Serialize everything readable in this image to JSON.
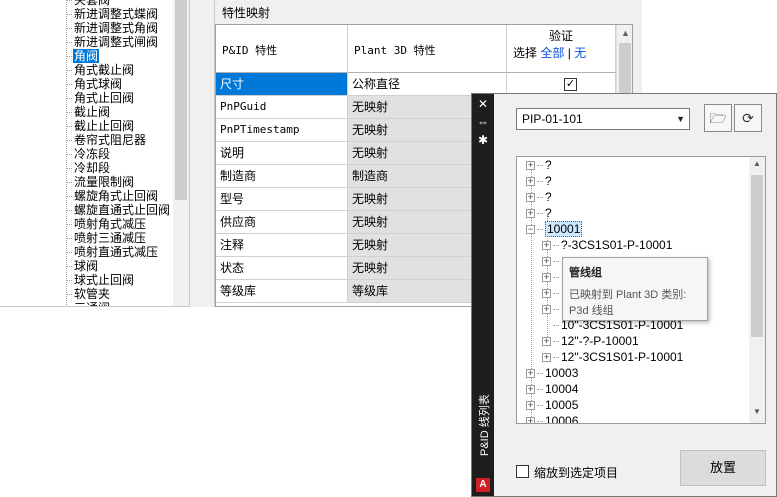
{
  "left_tree": {
    "items": [
      {
        "label": "夹套阀",
        "selected": false
      },
      {
        "label": "新进调整式蝶阀",
        "selected": false
      },
      {
        "label": "新进调整式角阀",
        "selected": false
      },
      {
        "label": "新进调整式闸阀",
        "selected": false
      },
      {
        "label": "角阀",
        "selected": true
      },
      {
        "label": "角式截止阀",
        "selected": false
      },
      {
        "label": "角式球阀",
        "selected": false
      },
      {
        "label": "角式止回阀",
        "selected": false
      },
      {
        "label": "截止阀",
        "selected": false
      },
      {
        "label": "截止止回阀",
        "selected": false
      },
      {
        "label": "卷帘式阻尼器",
        "selected": false
      },
      {
        "label": "冷冻段",
        "selected": false
      },
      {
        "label": "冷却段",
        "selected": false
      },
      {
        "label": "流量限制阀",
        "selected": false
      },
      {
        "label": "螺旋角式止回阀",
        "selected": false
      },
      {
        "label": "螺旋直通式止回阀",
        "selected": false
      },
      {
        "label": "喷射角式减压",
        "selected": false
      },
      {
        "label": "喷射三通减压",
        "selected": false
      },
      {
        "label": "喷射直通式减压",
        "selected": false
      },
      {
        "label": "球阀",
        "selected": false
      },
      {
        "label": "球式止回阀",
        "selected": false
      },
      {
        "label": "软管夹",
        "selected": false
      },
      {
        "label": "三通阀",
        "selected": false
      }
    ]
  },
  "mapping": {
    "title": "特性映射",
    "headers": {
      "pid": "P&ID 特性",
      "plant3d": "Plant 3D 特性",
      "verify": "验证",
      "select": "选择",
      "all": "全部",
      "sep": "|",
      "none": "无"
    },
    "rows": [
      {
        "pid": "尺寸",
        "plant": "公称直径",
        "combo": false,
        "checked": true,
        "selected": true,
        "mono": false
      },
      {
        "pid": "PnPGuid",
        "plant": "无映射",
        "combo": true,
        "checked": false,
        "selected": false,
        "mono": true
      },
      {
        "pid": "PnPTimestamp",
        "plant": "无映射",
        "combo": true,
        "checked": false,
        "selected": false,
        "mono": true
      },
      {
        "pid": "说明",
        "plant": "无映射",
        "combo": true,
        "checked": false,
        "selected": false,
        "mono": false
      },
      {
        "pid": "制造商",
        "plant": "制造商",
        "combo": true,
        "checked": false,
        "selected": false,
        "mono": false
      },
      {
        "pid": "型号",
        "plant": "无映射",
        "combo": true,
        "checked": false,
        "selected": false,
        "mono": false
      },
      {
        "pid": "供应商",
        "plant": "无映射",
        "combo": true,
        "checked": false,
        "selected": false,
        "mono": false
      },
      {
        "pid": "注释",
        "plant": "无映射",
        "combo": true,
        "checked": false,
        "selected": false,
        "mono": false
      },
      {
        "pid": "状态",
        "plant": "无映射",
        "combo": true,
        "checked": false,
        "selected": false,
        "mono": false
      },
      {
        "pid": "等级库",
        "plant": "等级库",
        "combo": true,
        "checked": false,
        "selected": false,
        "mono": false
      }
    ]
  },
  "palette": {
    "title": "P&ID 线列表",
    "close_glyph": "✕",
    "autohide_glyph": "⇔",
    "settings_glyph": "✱",
    "logo_letter": "A",
    "project": "PIP-01-101",
    "open_glyph": "🗁",
    "refresh_glyph": "⟳",
    "tree": [
      {
        "label": "?",
        "level": 0,
        "expander": "+",
        "selected": false
      },
      {
        "label": "?",
        "level": 0,
        "expander": "+",
        "selected": false
      },
      {
        "label": "?",
        "level": 0,
        "expander": "+",
        "selected": false
      },
      {
        "label": "?",
        "level": 0,
        "expander": "+",
        "selected": false
      },
      {
        "label": "10001",
        "level": 0,
        "expander": "−",
        "selected": true
      },
      {
        "label": "?-3CS1S01-P-10001",
        "level": 1,
        "expander": "+",
        "selected": false
      },
      {
        "label": "",
        "level": 1,
        "expander": "+",
        "selected": false
      },
      {
        "label": "",
        "level": 1,
        "expander": "+",
        "selected": false
      },
      {
        "label": "",
        "level": 1,
        "expander": "+",
        "selected": false
      },
      {
        "label": "",
        "level": 1,
        "expander": "+",
        "selected": false
      },
      {
        "label": "10\"-3CS1S01-P-10001",
        "level": 1,
        "expander": "",
        "selected": false
      },
      {
        "label": "12\"-?-P-10001",
        "level": 1,
        "expander": "+",
        "selected": false
      },
      {
        "label": "12\"-3CS1S01-P-10001",
        "level": 1,
        "expander": "+",
        "selected": false
      },
      {
        "label": "10003",
        "level": 0,
        "expander": "+",
        "selected": false
      },
      {
        "label": "10004",
        "level": 0,
        "expander": "+",
        "selected": false
      },
      {
        "label": "10005",
        "level": 0,
        "expander": "+",
        "selected": false
      },
      {
        "label": "10006",
        "level": 0,
        "expander": "+",
        "selected": false
      }
    ],
    "tooltip": {
      "title": "管线组",
      "line1": "已映射到 Plant 3D 类别:",
      "line2": "P3d 线组"
    },
    "zoom_label": "缩放到选定项目",
    "place_label": "放置"
  }
}
